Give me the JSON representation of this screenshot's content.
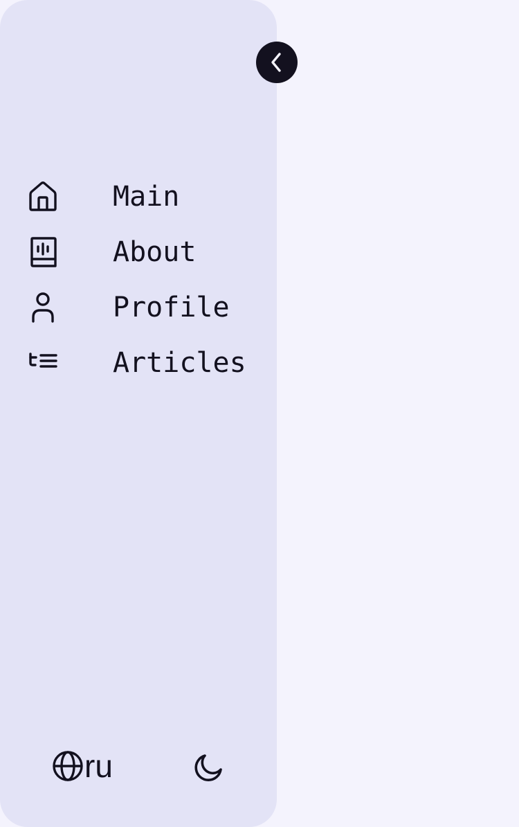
{
  "sidebar": {
    "collapse_button": {
      "icon": "chevron-left-icon"
    },
    "nav_items": [
      {
        "label": "Main",
        "icon": "home-icon"
      },
      {
        "label": "About",
        "icon": "book-icon"
      },
      {
        "label": "Profile",
        "icon": "user-icon"
      },
      {
        "label": "Articles",
        "icon": "list-icon"
      }
    ],
    "footer": {
      "language": {
        "icon": "globe-icon",
        "label": "ru"
      },
      "theme_toggle": {
        "icon": "moon-icon"
      }
    }
  },
  "colors": {
    "page_background": "#f4f3fd",
    "sidebar_background": "#e3e3f6",
    "primary": "#13111f",
    "button_icon": "#f4f3fd"
  }
}
